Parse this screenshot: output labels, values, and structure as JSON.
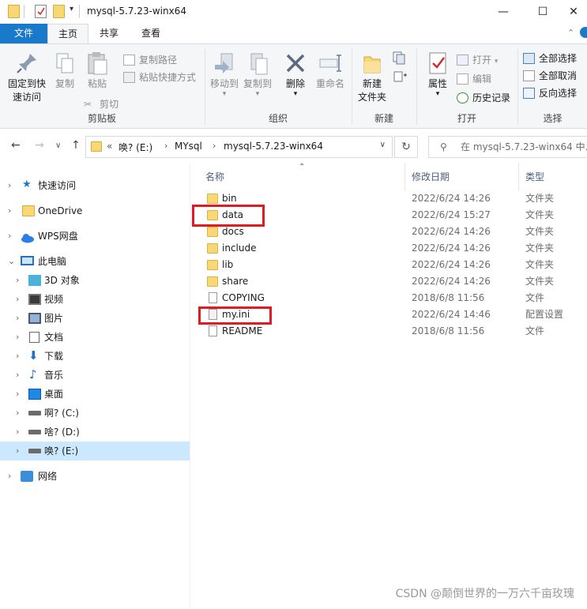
{
  "window": {
    "title": "mysql-5.7.23-winx64",
    "controls": [
      "—",
      "☐",
      "✕"
    ]
  },
  "tabs": [
    "文件",
    "主页",
    "共享",
    "查看"
  ],
  "ribbon": {
    "clipboard": {
      "group_label": "剪贴板",
      "pin": "固定到快\n速访问",
      "copy": "复制",
      "paste": "粘贴",
      "copy_path": "复制路径",
      "paste_shortcut": "粘贴快捷方式",
      "cut": "剪切"
    },
    "organize": {
      "group_label": "组织",
      "move_to": "移动到",
      "copy_to": "复制到",
      "delete": "删除",
      "rename": "重命名"
    },
    "new": {
      "group_label": "新建",
      "new_folder": "新建\n文件夹"
    },
    "open": {
      "group_label": "打开",
      "properties": "属性",
      "open": "打开",
      "edit": "编辑",
      "history": "历史记录"
    },
    "select": {
      "group_label": "选择",
      "select_all": "全部选择",
      "select_none": "全部取消",
      "invert": "反向选择"
    }
  },
  "address": {
    "crumbs": [
      "唤?  (E:)",
      "MYsql",
      "mysql-5.7.23-winx64"
    ],
    "overflow": "«",
    "search_placeholder": "在 mysql-5.7.23-winx64 中..."
  },
  "nav": {
    "items": [
      {
        "label": "快速访问",
        "icon": "star-icon"
      },
      {
        "label": "OneDrive",
        "icon": "folder-icon"
      },
      {
        "label": "WPS网盘",
        "icon": "cloud-icon"
      },
      {
        "label": "此电脑",
        "icon": "computer-icon"
      },
      {
        "label": "3D 对象",
        "icon": "cube-icon"
      },
      {
        "label": "视频",
        "icon": "video-icon"
      },
      {
        "label": "图片",
        "icon": "picture-icon"
      },
      {
        "label": "文档",
        "icon": "document-icon"
      },
      {
        "label": "下载",
        "icon": "download-icon"
      },
      {
        "label": "音乐",
        "icon": "music-icon"
      },
      {
        "label": "桌面",
        "icon": "desktop-icon"
      },
      {
        "label": "啊?  (C:)",
        "icon": "drive-icon"
      },
      {
        "label": "啥?  (D:)",
        "icon": "drive-icon"
      },
      {
        "label": "唤?  (E:)",
        "icon": "drive-icon"
      },
      {
        "label": "网络",
        "icon": "network-icon"
      }
    ]
  },
  "columns": {
    "name": "名称",
    "date": "修改日期",
    "type": "类型"
  },
  "files": [
    {
      "name": "bin",
      "date": "2022/6/24 14:26",
      "type": "文件夹",
      "kind": "folder"
    },
    {
      "name": "data",
      "date": "2022/6/24 15:27",
      "type": "文件夹",
      "kind": "folder"
    },
    {
      "name": "docs",
      "date": "2022/6/24 14:26",
      "type": "文件夹",
      "kind": "folder"
    },
    {
      "name": "include",
      "date": "2022/6/24 14:26",
      "type": "文件夹",
      "kind": "folder"
    },
    {
      "name": "lib",
      "date": "2022/6/24 14:26",
      "type": "文件夹",
      "kind": "folder"
    },
    {
      "name": "share",
      "date": "2022/6/24 14:26",
      "type": "文件夹",
      "kind": "folder"
    },
    {
      "name": "COPYING",
      "date": "2018/6/8 11:56",
      "type": "文件",
      "kind": "file"
    },
    {
      "name": "my.ini",
      "date": "2022/6/24 14:46",
      "type": "配置设置",
      "kind": "ini"
    },
    {
      "name": "README",
      "date": "2018/6/8 11:56",
      "type": "文件",
      "kind": "file"
    }
  ],
  "watermark": "CSDN @颠倒世界的一万六千亩玫瑰",
  "colors": {
    "accent": "#1979ca",
    "highlight": "#e11b22",
    "selection": "#cce8ff"
  }
}
